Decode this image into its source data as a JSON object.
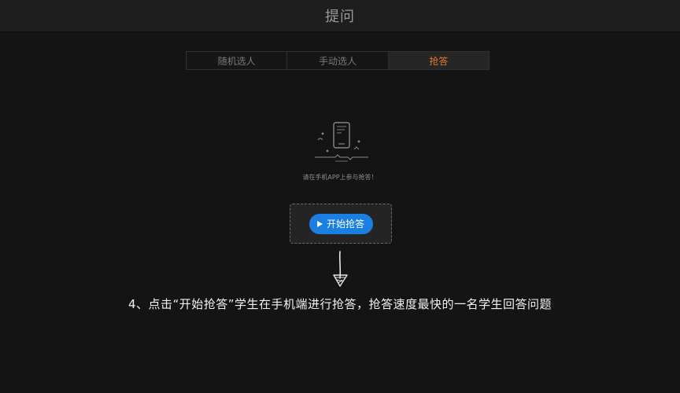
{
  "window": {
    "title": "提问"
  },
  "tabs": [
    {
      "label": "随机选人",
      "active": false
    },
    {
      "label": "手动选人",
      "active": false
    },
    {
      "label": "抢答",
      "active": true
    }
  ],
  "illustration": {
    "icon": "phone-icon"
  },
  "hint": {
    "text": "请在手机APP上参与抢答！"
  },
  "start_button": {
    "label": "开始抢答",
    "icon": "play-icon"
  },
  "annotation": {
    "arrow_icon": "hand-drawn-arrow-icon",
    "text": "4、点击“开始抢答”学生在手机端进行抢答，抢答速度最快的一名学生回答问题"
  },
  "colors": {
    "accent_active_tab": "#e0782a",
    "button_blue": "#1a7fe0",
    "background": "#141414"
  }
}
